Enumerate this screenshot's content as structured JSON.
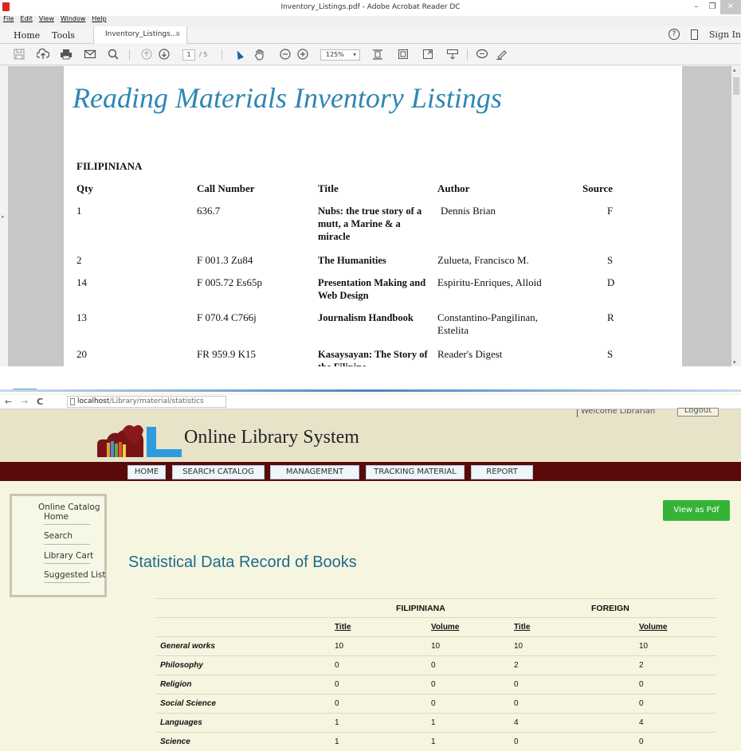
{
  "acrobat": {
    "window_title": "Inventory_Listings.pdf - Adobe Acrobat Reader DC",
    "window_controls": [
      "–",
      "❐",
      "✕"
    ],
    "menu": [
      "File",
      "Edit",
      "View",
      "Window",
      "Help"
    ],
    "nav_tabs": [
      "Home",
      "Tools"
    ],
    "doc_tab": "Inventory_Listings....",
    "doc_tab_close": "×",
    "help_label": "?",
    "sign_in": "Sign In",
    "toolbar": {
      "page_current": "1",
      "page_total": "/ 5",
      "zoom": "125%",
      "zoom_caret": "▾",
      "icons": [
        "save-icon",
        "upload-icon",
        "print-icon",
        "email-icon",
        "search-icon",
        "page-up-icon",
        "page-down-icon",
        "select-cursor-icon",
        "hand-icon",
        "zoom-out-icon",
        "zoom-in-icon",
        "fit-page-icon",
        "full-width-icon",
        "full-screen-icon",
        "read-mode-icon",
        "comment-icon",
        "highlight-icon"
      ]
    },
    "document": {
      "title": "Reading Materials Inventory Listings",
      "section": "FILIPINIANA",
      "headers": [
        "Qty",
        "Call Number",
        "Title",
        "Author",
        "Source"
      ],
      "rows": [
        {
          "qty": "1",
          "call": "636.7",
          "title": "Nubs: the true story of a mutt, a Marine & a miracle",
          "author": "Dennis Brian",
          "source": "F"
        },
        {
          "qty": "2",
          "call": "F 001.3 Zu84",
          "title": "The Humanities",
          "author": "Zulueta, Francisco M.",
          "source": "S"
        },
        {
          "qty": "14",
          "call": "F 005.72 Es65p",
          "title": "Presentation Making and Web Design",
          "author": "Espiritu-Enriques, Alloid",
          "source": "D"
        },
        {
          "qty": "13",
          "call": "F 070.4 C766j",
          "title": "Journalism Handbook",
          "author": "Constantino-Pangilinan, Estelita",
          "source": "R"
        },
        {
          "qty": "20",
          "call": "FR 959.9 K15",
          "title": "Kasaysayan: The Story of the Filipino",
          "author": "Reader's Digest",
          "source": "S"
        }
      ]
    }
  },
  "browser": {
    "back": "←",
    "forward": "→",
    "reload": "C",
    "url_host": "localhost",
    "url_path": "/Library/material/statistics",
    "welcome": "Welcome Librarian",
    "logout": "Logout",
    "site_name": "Online Library System",
    "nav": [
      "HOME",
      "SEARCH CATALOG",
      "MANAGEMENT",
      "TRACKING MATERIAL",
      "REPORT"
    ],
    "sidebar": {
      "heading": "Online Catalog",
      "items": [
        "Home",
        "Search",
        "Library Cart",
        "Suggested List"
      ]
    },
    "view_pdf": "View as Pdf",
    "page_title": "Statistical Data Record of Books",
    "stats": {
      "groups": [
        "FILIPINIANA",
        "FOREIGN"
      ],
      "subheaders": [
        "Title",
        "Volume",
        "Title",
        "Volume"
      ],
      "rows": [
        {
          "category": "General works",
          "values": [
            "10",
            "10",
            "10",
            "10"
          ]
        },
        {
          "category": "Philosophy",
          "values": [
            "0",
            "0",
            "2",
            "2"
          ]
        },
        {
          "category": "Religion",
          "values": [
            "0",
            "0",
            "0",
            "0"
          ]
        },
        {
          "category": "Social Science",
          "values": [
            "0",
            "0",
            "0",
            "0"
          ]
        },
        {
          "category": "Languages",
          "values": [
            "1",
            "1",
            "4",
            "4"
          ]
        },
        {
          "category": "Science",
          "values": [
            "1",
            "1",
            "0",
            "0"
          ]
        }
      ]
    }
  },
  "colors": {
    "pdf_title": "#2e86b4",
    "nav_bar": "#5a0a0a",
    "pdf_button": "#36b336",
    "stat_title": "#1f6a8e",
    "header_bg": "#e7e3c9",
    "content_bg": "#f6f6e0"
  }
}
